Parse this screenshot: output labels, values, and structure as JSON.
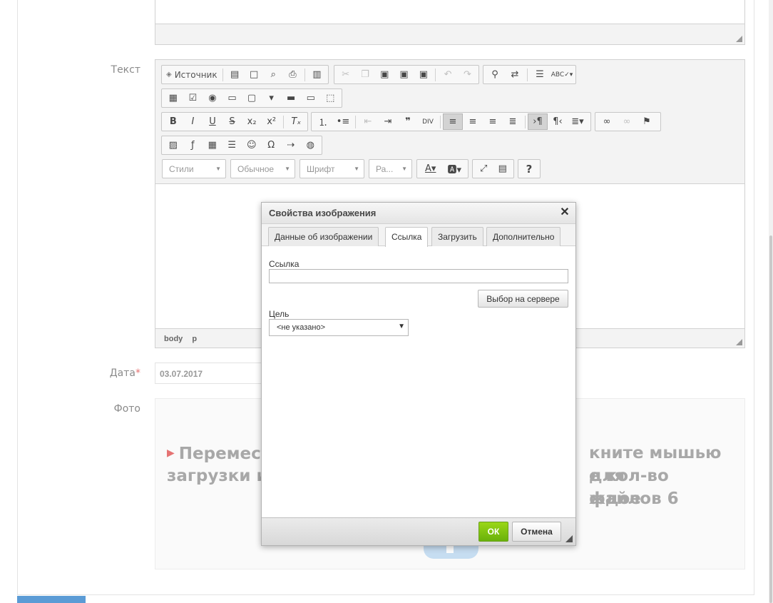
{
  "form": {
    "text_label": "Текст",
    "date_label": "Дата",
    "required_mark": "*",
    "date_value": "03.07.2017",
    "photo_label": "Фото"
  },
  "toolbar": {
    "source_label": "Источник",
    "styles_combo": "Стили",
    "format_combo": "Обычное",
    "font_combo": "Шрифт",
    "size_combo": "Ра...",
    "help_label": "?"
  },
  "editor": {
    "path_items": [
      "body",
      "p"
    ]
  },
  "dropzone": {
    "line1_left": "Перемест",
    "line1_right": "кните мышью для",
    "line2_left": "загрузки и",
    "line2_right": "е кол-во файлов 6",
    "line3_right": "ждое"
  },
  "dialog": {
    "title": "Свойства изображения",
    "close_glyph": "✕",
    "tabs": [
      "Данные об изображении",
      "Ссылка",
      "Загрузить",
      "Дополнительно"
    ],
    "active_tab": "Ссылка",
    "link_label": "Ссылка",
    "link_value": "",
    "browse_button": "Выбор на сервере",
    "target_label": "Цель",
    "target_value": "<не указано>",
    "ok_button": "ОК",
    "cancel_button": "Отмена"
  },
  "colors": {
    "ok_green": "#76c00f",
    "required_red": "#e57373",
    "upload_blue": "#c6ddf1"
  }
}
